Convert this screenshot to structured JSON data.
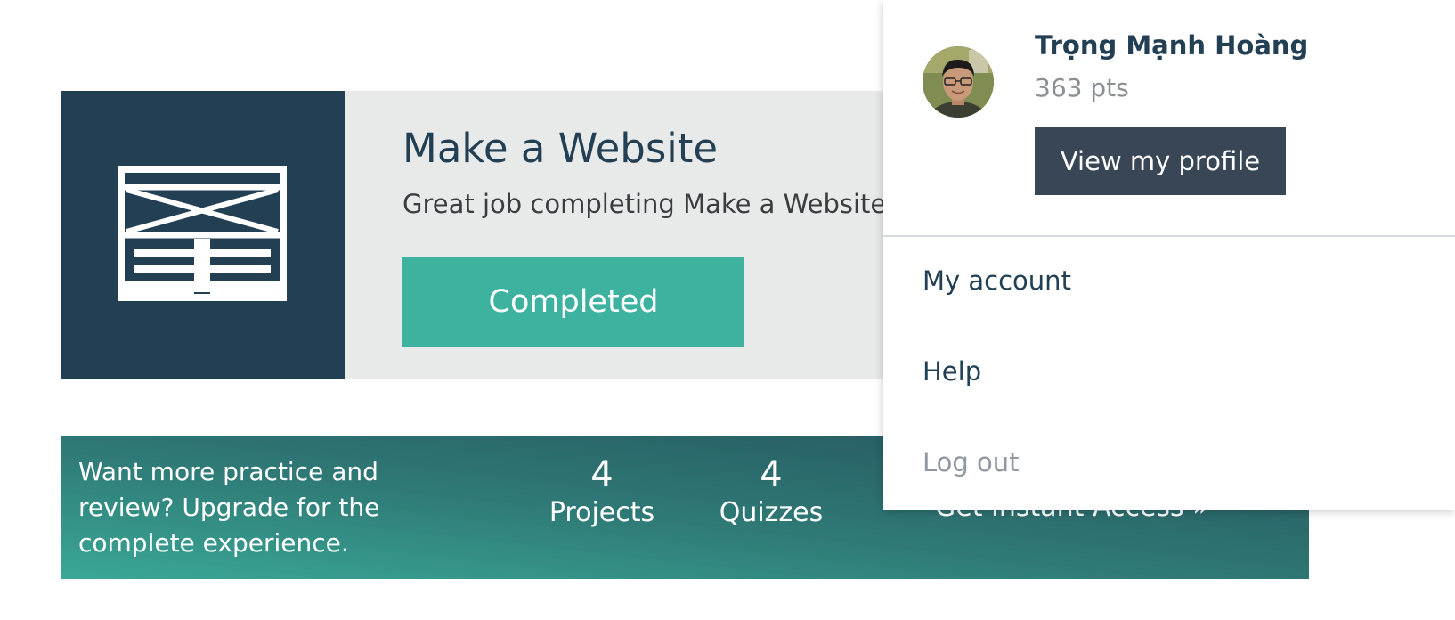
{
  "course": {
    "title": "Make a Website",
    "description": "Great job completing Make a Website!",
    "status_button": "Completed",
    "icon": "website-layout-icon"
  },
  "upgrade": {
    "text": "Want more practice and review? Upgrade for the complete experience.",
    "stats": [
      {
        "value": "4",
        "label": "Projects"
      },
      {
        "value": "4",
        "label": "Quizzes"
      }
    ],
    "cta": "Get Instant Access »"
  },
  "dropdown": {
    "user_name": "Trọng Mạnh Hoàng",
    "points": "363 pts",
    "view_profile": "View my profile",
    "menu": [
      {
        "label": "My account"
      },
      {
        "label": "Help"
      },
      {
        "label": "Log out"
      }
    ]
  },
  "colors": {
    "navy": "#223f54",
    "teal": "#3cb29f",
    "card_bg": "#e8eaea",
    "profile_button": "#384655",
    "muted": "#8a8f94"
  }
}
